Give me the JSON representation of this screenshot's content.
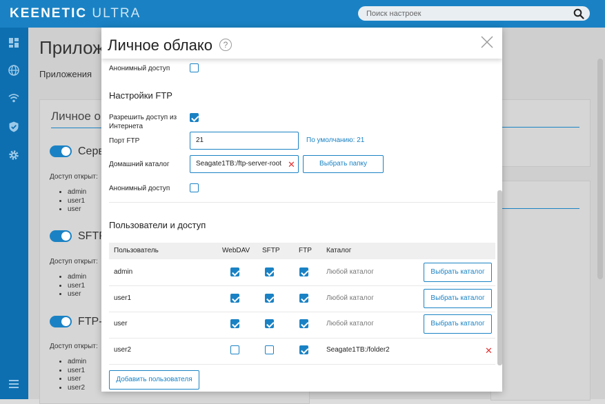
{
  "brand": {
    "name_bold": "KEENETIC",
    "name_light": "ULTRA"
  },
  "search": {
    "placeholder": "Поиск настроек"
  },
  "sidebar": {
    "icons": [
      "dashboard-icon",
      "globe-icon",
      "wifi-icon",
      "shield-icon",
      "gear-icon",
      "menu-icon"
    ]
  },
  "background_page": {
    "title": "Приложе",
    "tab": "Приложения",
    "card_title": "Личное о",
    "sections": [
      {
        "label": "Серв",
        "access_label": "Доступ открыт:",
        "users": [
          "admin",
          "user1",
          "user"
        ]
      },
      {
        "label": "SFTP",
        "access_label": "Доступ открыт:",
        "users": [
          "admin",
          "user1",
          "user"
        ]
      },
      {
        "label": "FTP-",
        "access_label": "Доступ открыт:",
        "users": [
          "admin",
          "user1",
          "user",
          "user2"
        ]
      }
    ]
  },
  "modal": {
    "title": "Личное облако",
    "help": "?",
    "anon_top": {
      "label": "Анонимный доступ",
      "checked": false
    },
    "ftp_section": "Настройки FTP",
    "allow_internet": {
      "label": "Разрешить доступ из Интернета",
      "checked": true
    },
    "ftp_port": {
      "label": "Порт FTP",
      "value": "21",
      "hint": "По умолчанию: 21"
    },
    "home_dir": {
      "label": "Домашний каталог",
      "value": "Seagate1TB:/ftp-server-root",
      "button": "Выбрать папку"
    },
    "anon_ftp": {
      "label": "Анонимный доступ",
      "checked": false
    },
    "users_section": "Пользователи и доступ",
    "table": {
      "headers": [
        "Пользователь",
        "WebDAV",
        "SFTP",
        "FTP",
        "Каталог"
      ],
      "rows": [
        {
          "user": "admin",
          "webdav": true,
          "sftp": true,
          "ftp": true,
          "catalog": "Любой каталог",
          "button": "Выбрать каталог"
        },
        {
          "user": "user1",
          "webdav": true,
          "sftp": true,
          "ftp": true,
          "catalog": "Любой каталог",
          "button": "Выбрать каталог"
        },
        {
          "user": "user",
          "webdav": true,
          "sftp": true,
          "ftp": true,
          "catalog": "Любой каталог",
          "button": "Выбрать каталог"
        },
        {
          "user": "user2",
          "webdav": false,
          "sftp": false,
          "ftp": true,
          "catalog": "Seagate1TB:/folder2",
          "button": ""
        }
      ]
    },
    "add_user": "Добавить пользователя"
  },
  "colors": {
    "accent": "#1a82c4",
    "sidebar": "#0d6fb0",
    "remove": "#e03030"
  }
}
